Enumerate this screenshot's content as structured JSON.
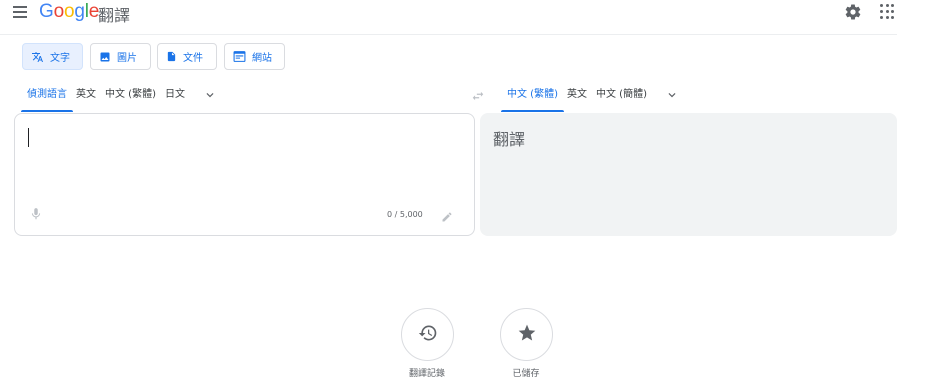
{
  "header": {
    "menu_icon": "hamburger-menu-icon",
    "logo_text": "Google",
    "product_name": "翻譯",
    "settings_icon": "gear-icon",
    "apps_icon": "apps-grid-icon"
  },
  "mode_tabs": [
    {
      "label": "文字",
      "icon": "translate-icon",
      "active": true
    },
    {
      "label": "圖片",
      "icon": "image-icon",
      "active": false
    },
    {
      "label": "文件",
      "icon": "document-icon",
      "active": false
    },
    {
      "label": "網站",
      "icon": "website-icon",
      "active": false
    }
  ],
  "source_languages": [
    {
      "label": "偵測語言",
      "active": true
    },
    {
      "label": "英文",
      "active": false
    },
    {
      "label": "中文 (繁體)",
      "active": false
    },
    {
      "label": "日文",
      "active": false
    }
  ],
  "target_languages": [
    {
      "label": "中文 (繁體)",
      "active": true
    },
    {
      "label": "英文",
      "active": false
    },
    {
      "label": "中文 (簡體)",
      "active": false
    }
  ],
  "source_panel": {
    "value": "",
    "char_count": "0 / 5,000"
  },
  "target_panel": {
    "placeholder": "翻譯"
  },
  "actions": {
    "history_label": "翻譯記錄",
    "saved_label": "已儲存"
  },
  "colors": {
    "accent": "#1a73e8",
    "active_tab_bg": "#e8f0fe",
    "target_panel_bg": "#f1f3f4",
    "border": "#dadce0"
  }
}
